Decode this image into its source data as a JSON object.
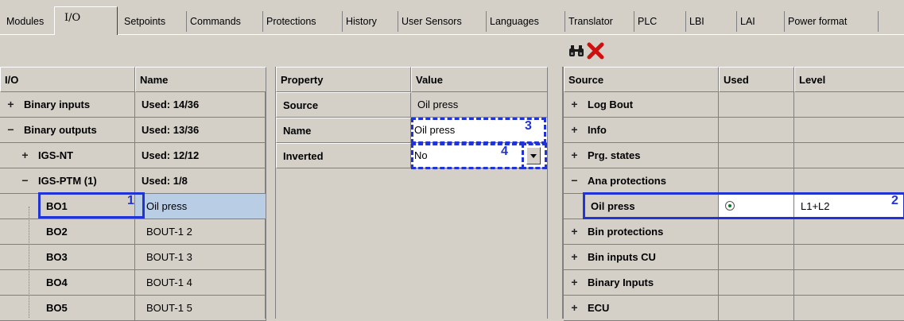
{
  "tabs": [
    "Modules",
    "I/O",
    "Setpoints",
    "Commands",
    "Protections",
    "History",
    "User Sensors",
    "Languages",
    "Translator",
    "PLC",
    "LBI",
    "LAI",
    "Power format"
  ],
  "active_tab": "I/O",
  "left": {
    "headers": [
      "I/O",
      "Name"
    ],
    "rows": [
      {
        "label": "Binary inputs",
        "name": "Used: 14/36"
      },
      {
        "label": "Binary outputs",
        "name": "Used: 13/36"
      },
      {
        "label": "IGS-NT",
        "name": "Used: 12/12"
      },
      {
        "label": "IGS-PTM (1)",
        "name": "Used: 1/8"
      },
      {
        "label": "BO1",
        "name": "Oil press"
      },
      {
        "label": "BO2",
        "name": "BOUT-1 2"
      },
      {
        "label": "BO3",
        "name": "BOUT-1 3"
      },
      {
        "label": "BO4",
        "name": "BOUT-1 4"
      },
      {
        "label": "BO5",
        "name": "BOUT-1 5"
      }
    ]
  },
  "middle": {
    "headers": [
      "Property",
      "Value"
    ],
    "rows": [
      {
        "property": "Source",
        "value": "Oil press"
      },
      {
        "property": "Name",
        "value": "Oil press"
      },
      {
        "property": "Inverted",
        "value": "No"
      }
    ]
  },
  "right": {
    "headers": [
      "Source",
      "Used",
      "Level"
    ],
    "rows": [
      {
        "source": "Log Bout",
        "used": "",
        "level": ""
      },
      {
        "source": "Info",
        "used": "",
        "level": ""
      },
      {
        "source": "Prg. states",
        "used": "",
        "level": ""
      },
      {
        "source": "Ana protections",
        "used": "",
        "level": ""
      },
      {
        "source": "Oil press",
        "used": "",
        "level": "L1+L2"
      },
      {
        "source": "Bin protections",
        "used": "",
        "level": ""
      },
      {
        "source": "Bin inputs CU",
        "used": "",
        "level": ""
      },
      {
        "source": "Binary Inputs",
        "used": "",
        "level": ""
      },
      {
        "source": "ECU",
        "used": "",
        "level": ""
      }
    ]
  },
  "callouts": [
    "1",
    "2",
    "3",
    "4"
  ],
  "colors": {
    "callout": "#1f33d6",
    "selection": "#b9cde5",
    "delete_icon": "#d01010"
  }
}
